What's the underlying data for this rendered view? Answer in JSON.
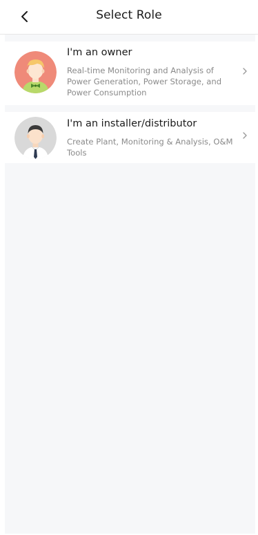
{
  "header": {
    "title": "Select Role",
    "back_icon": "chevron-left-icon"
  },
  "roles": [
    {
      "title": "I'm an owner",
      "description": "Real-time Monitoring and Analysis of Power Generation, Power Storage, and Power Consumption",
      "avatar_icon": "owner-avatar-icon",
      "chevron_icon": "chevron-right-icon"
    },
    {
      "title": "I'm an installer/distributor",
      "description": "Create Plant, Monitoring & Analysis, O&M Tools",
      "avatar_icon": "installer-avatar-icon",
      "chevron_icon": "chevron-right-icon"
    }
  ],
  "colors": {
    "background": "#f6f7f9",
    "card": "#ffffff",
    "title_text": "#1a1a1a",
    "description_text": "#8a8a8a",
    "owner_avatar_bg": "#ef8a79",
    "installer_avatar_bg": "#d9d9d9"
  }
}
